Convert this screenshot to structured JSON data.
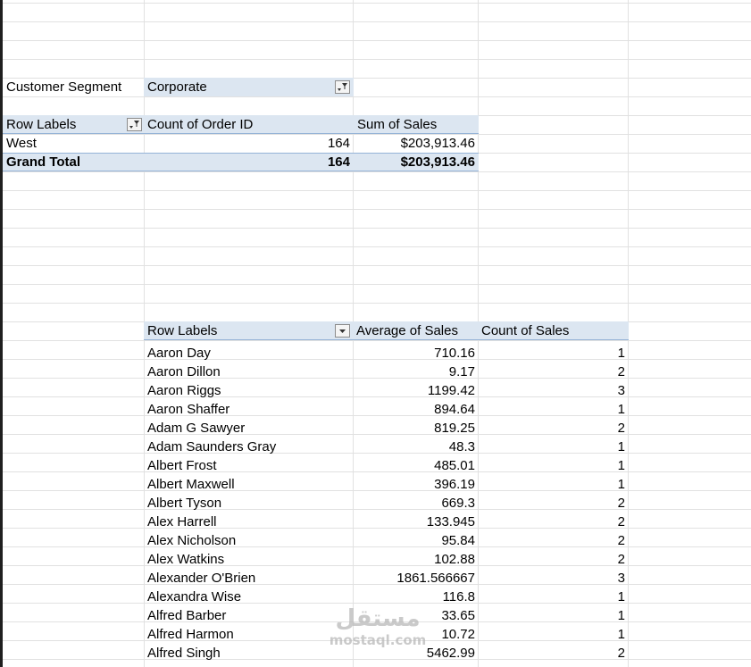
{
  "filter": {
    "label": "Customer Segment",
    "value": "Corporate"
  },
  "pivot1": {
    "headers": [
      "Row Labels",
      "Count of Order ID",
      "Sum of Sales"
    ],
    "rows": [
      {
        "label": "West",
        "count": "164",
        "sum": "$203,913.46"
      }
    ],
    "total": {
      "label": "Grand Total",
      "count": "164",
      "sum": "$203,913.46"
    }
  },
  "pivot2": {
    "headers": [
      "Row Labels",
      "Average of Sales",
      "Count of Sales"
    ],
    "rows": [
      {
        "name": "Aaron Day",
        "avg": "710.16",
        "count": "1"
      },
      {
        "name": "Aaron Dillon",
        "avg": "9.17",
        "count": "2"
      },
      {
        "name": "Aaron Riggs",
        "avg": "1199.42",
        "count": "3"
      },
      {
        "name": "Aaron Shaffer",
        "avg": "894.64",
        "count": "1"
      },
      {
        "name": "Adam G Sawyer",
        "avg": "819.25",
        "count": "2"
      },
      {
        "name": "Adam Saunders Gray",
        "avg": "48.3",
        "count": "1"
      },
      {
        "name": "Albert Frost",
        "avg": "485.01",
        "count": "1"
      },
      {
        "name": "Albert Maxwell",
        "avg": "396.19",
        "count": "1"
      },
      {
        "name": "Albert Tyson",
        "avg": "669.3",
        "count": "2"
      },
      {
        "name": "Alex Harrell",
        "avg": "133.945",
        "count": "2"
      },
      {
        "name": "Alex Nicholson",
        "avg": "95.84",
        "count": "2"
      },
      {
        "name": "Alex Watkins",
        "avg": "102.88",
        "count": "2"
      },
      {
        "name": "Alexander O'Brien",
        "avg": "1861.566667",
        "count": "3"
      },
      {
        "name": "Alexandra Wise",
        "avg": "116.8",
        "count": "1"
      },
      {
        "name": "Alfred Barber",
        "avg": "33.65",
        "count": "1"
      },
      {
        "name": "Alfred Harmon",
        "avg": "10.72",
        "count": "1"
      },
      {
        "name": "Alfred Singh",
        "avg": "5462.99",
        "count": "2"
      }
    ]
  },
  "watermark": {
    "arabic": "مستقل",
    "latin": "mostaql.com"
  },
  "colors": {
    "header_band": "#dce6f1",
    "band_border": "#95b3d7",
    "gridline": "#e1e1e1"
  }
}
